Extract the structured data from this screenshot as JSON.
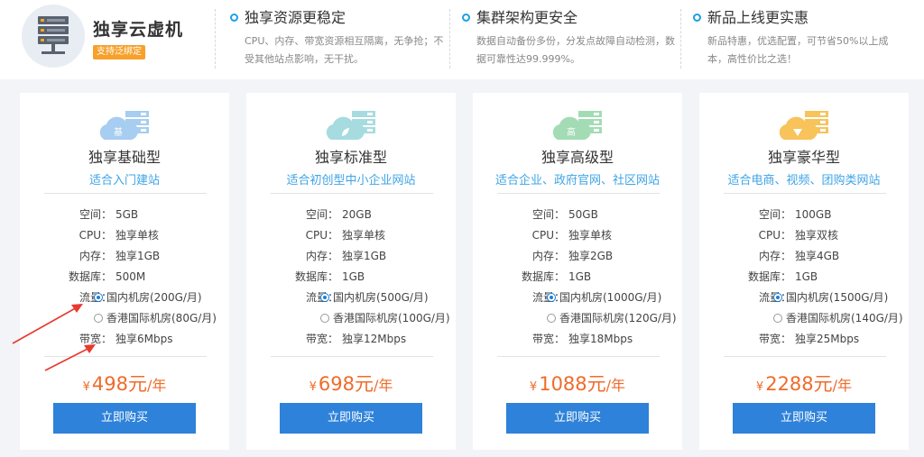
{
  "brand": {
    "title": "独享云虚机",
    "badge": "支持泛绑定",
    "icon": "server-rack-icon"
  },
  "features": [
    {
      "title": "独享资源更稳定",
      "desc": "CPU、内存、带宽资源相互隔离，无争抢；不受其他站点影响，无干扰。"
    },
    {
      "title": "集群架构更安全",
      "desc": "数据自动备份多份，分发点故障自动检测，数据可靠性达99.999%。"
    },
    {
      "title": "新品上线更实惠",
      "desc": "新品特惠，优选配置，可节省50%以上成本，高性价比之选！"
    }
  ],
  "labels": {
    "space": "空间：",
    "cpu": "CPU：",
    "memory": "内存：",
    "database": "数据库：",
    "traffic": "流量：",
    "bandwidth": "带宽："
  },
  "plans": [
    {
      "logo_char": "基",
      "logo_color": "#a7cdf0",
      "title": "独享基础型",
      "subtitle": "适合入门建站",
      "space": "5GB",
      "cpu": "独享单核",
      "memory": "独享1GB",
      "database": "500M",
      "traffic_options": [
        "国内机房(200G/月)",
        "香港国际机房(80G/月)"
      ],
      "traffic_selected": 0,
      "bandwidth": "独享6Mbps",
      "currency": "¥",
      "price": "498元",
      "unit": "/年",
      "buy_label": "立即购买"
    },
    {
      "logo_char": "",
      "logo_color": "#a6dbe0",
      "title": "独享标准型",
      "subtitle": "适合初创型中小企业网站",
      "space": "20GB",
      "cpu": "独享单核",
      "memory": "独享1GB",
      "database": "1GB",
      "traffic_options": [
        "国内机房(500G/月)",
        "香港国际机房(100G/月)"
      ],
      "traffic_selected": 0,
      "bandwidth": "独享12Mbps",
      "currency": "¥",
      "price": "698元",
      "unit": "/年",
      "buy_label": "立即购买"
    },
    {
      "logo_char": "高",
      "logo_color": "#a3dcb4",
      "title": "独享高级型",
      "subtitle": "适合企业、政府官网、社区网站",
      "space": "50GB",
      "cpu": "独享单核",
      "memory": "独享2GB",
      "database": "1GB",
      "traffic_options": [
        "国内机房(1000G/月)",
        "香港国际机房(120G/月)"
      ],
      "traffic_selected": 0,
      "bandwidth": "独享18Mbps",
      "currency": "¥",
      "price": "1088元",
      "unit": "/年",
      "buy_label": "立即购买"
    },
    {
      "logo_char": "",
      "logo_color": "#f7c35a",
      "title": "独享豪华型",
      "subtitle": "适合电商、视频、团购类网站",
      "space": "100GB",
      "cpu": "独享双核",
      "memory": "独享4GB",
      "database": "1GB",
      "traffic_options": [
        "国内机房(1500G/月)",
        "香港国际机房(140G/月)"
      ],
      "traffic_selected": 0,
      "bandwidth": "独享25Mbps",
      "currency": "¥",
      "price": "2288元",
      "unit": "/年",
      "buy_label": "立即购买"
    }
  ],
  "colors": {
    "accent": "#2e82d9",
    "subtitle": "#3ea4e6",
    "price": "#ef6b2a",
    "badge": "#f7a02a",
    "annotation_arrow": "#e8392f"
  }
}
